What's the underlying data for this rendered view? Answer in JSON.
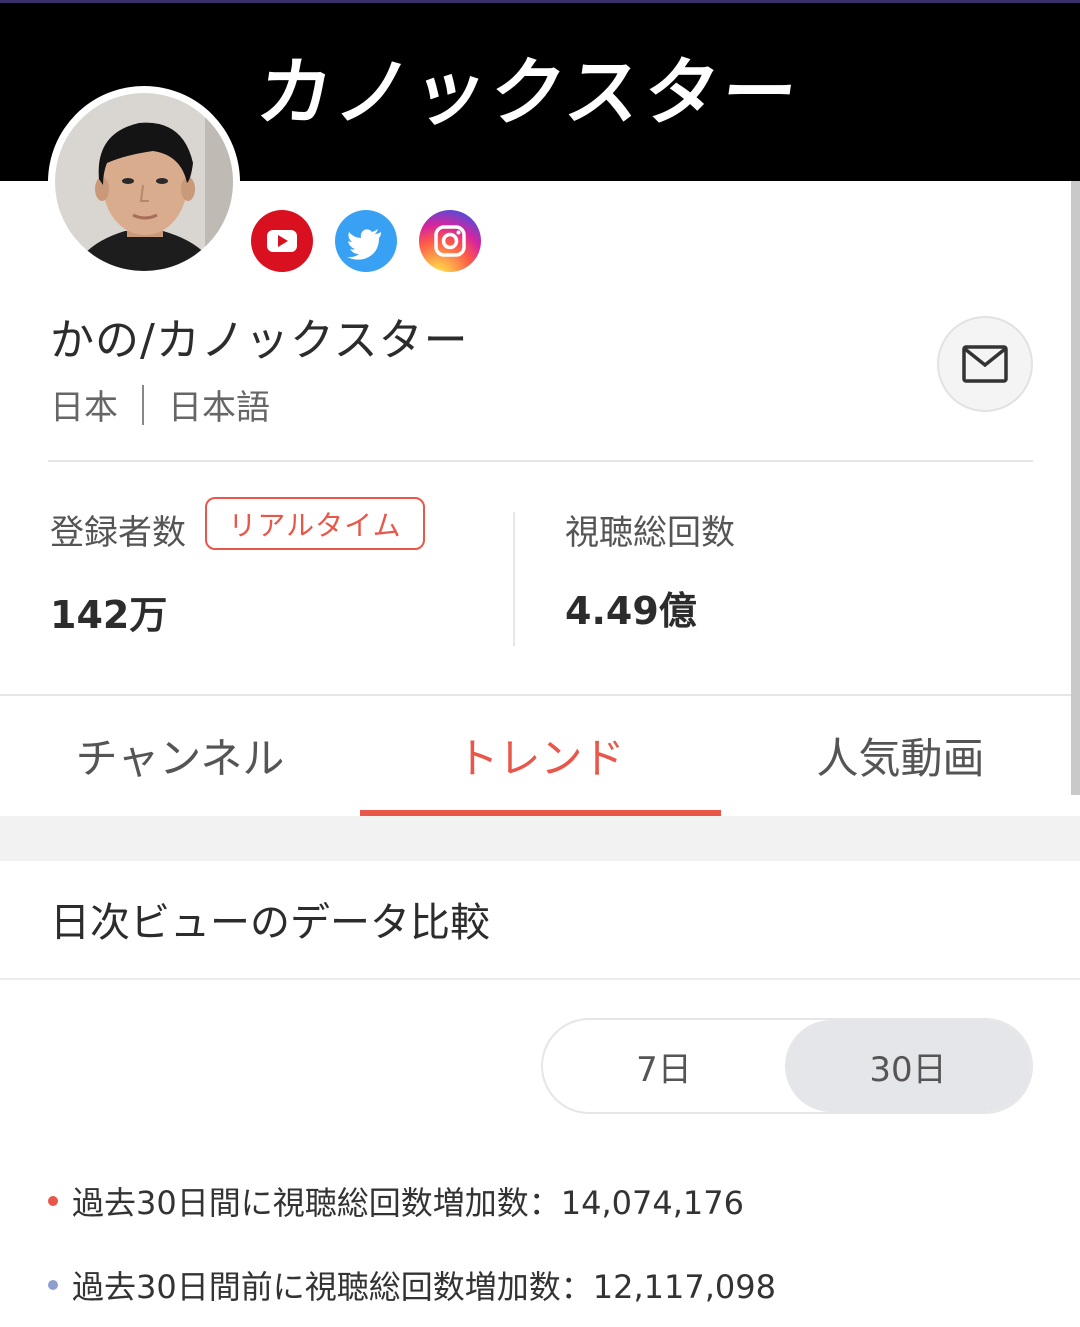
{
  "banner": {
    "title": "カノックスター"
  },
  "profile": {
    "name": "かの/カノックスター",
    "country": "日本",
    "language": "日本語"
  },
  "social": [
    {
      "icon": "youtube-icon",
      "color": "#d8101f"
    },
    {
      "icon": "twitter-icon",
      "color": "#38a1f3"
    },
    {
      "icon": "instagram-icon",
      "color": "#d6249f"
    }
  ],
  "stats": {
    "subscribers_label": "登録者数",
    "realtime_badge": "リアルタイム",
    "subscribers_value": "142万",
    "views_label": "視聴総回数",
    "views_value": "4.49億"
  },
  "tabs": [
    {
      "label": "チャンネル",
      "active": false
    },
    {
      "label": "トレンド",
      "active": true
    },
    {
      "label": "人気動画",
      "active": false
    }
  ],
  "section": {
    "title": "日次ビューのデータ比較",
    "range_options": [
      "7日",
      "30日"
    ],
    "selected_range": "30日",
    "lines": [
      {
        "text": "過去30日間に視聴総回数増加数：14,074,176",
        "dot_color": "#e9574a"
      },
      {
        "text": "過去30日間前に視聴総回数増加数：12,117,098",
        "dot_color": "#8e9fcf"
      }
    ]
  },
  "colors": {
    "accent": "#e9574a",
    "banner_bg": "#000000"
  }
}
